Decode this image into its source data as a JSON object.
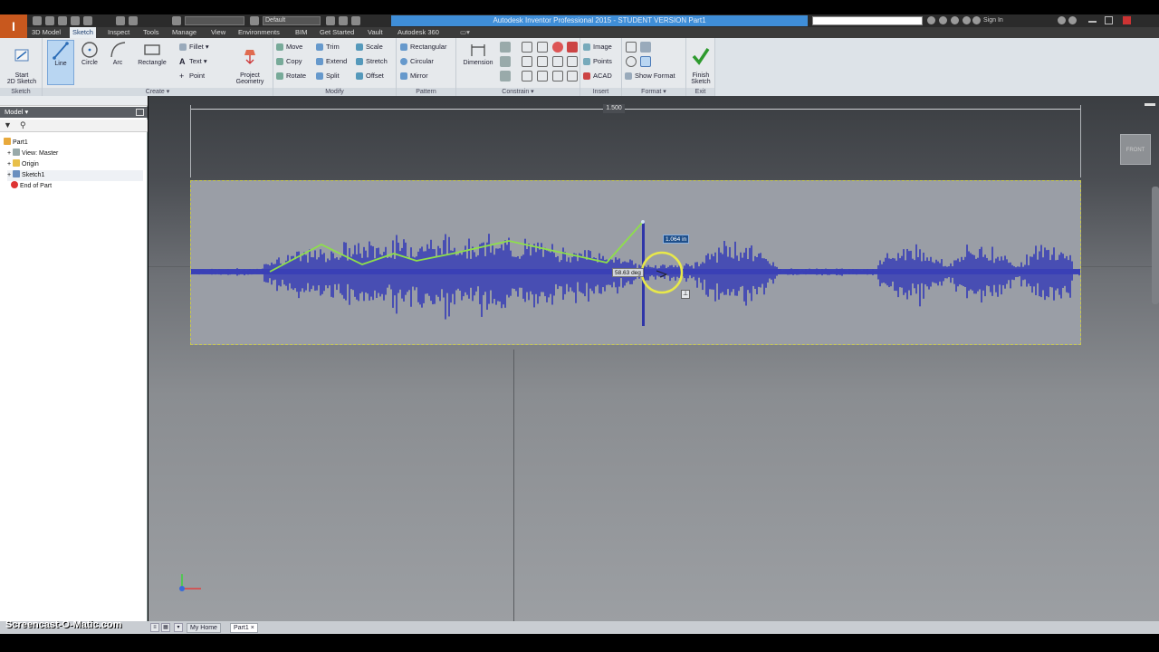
{
  "app": {
    "title": "Autodesk Inventor Professional 2015 - STUDENT VERSION   Part1",
    "logo_letter": "I",
    "appearance_value": "Default",
    "signin_label": "Sign In",
    "colors": {
      "accent": "#3f8ed8",
      "ribbon": "#e6e9ec",
      "brand": "#c8581e"
    }
  },
  "tabs": [
    {
      "label": "3D Model"
    },
    {
      "label": "Sketch",
      "active": true
    },
    {
      "label": "Inspect"
    },
    {
      "label": "Tools"
    },
    {
      "label": "Manage"
    },
    {
      "label": "View"
    },
    {
      "label": "Environments"
    },
    {
      "label": "BIM"
    },
    {
      "label": "Get Started"
    },
    {
      "label": "Vault"
    },
    {
      "label": "Autodesk 360"
    }
  ],
  "ribbon": {
    "sketch": {
      "panel": "Sketch",
      "start": "Start\n2D Sketch"
    },
    "create": {
      "panel": "Create ▾",
      "line": "Line",
      "circle": "Circle",
      "arc": "Arc",
      "rectangle": "Rectangle",
      "fillet": "Fillet",
      "text": "Text",
      "point": "Point",
      "project": "Project\nGeometry"
    },
    "modify": {
      "panel": "Modify",
      "move": "Move",
      "trim": "Trim",
      "scale": "Scale",
      "copy": "Copy",
      "extend": "Extend",
      "stretch": "Stretch",
      "rotate": "Rotate",
      "split": "Split",
      "offset": "Offset"
    },
    "pattern": {
      "panel": "Pattern",
      "rectangular": "Rectangular",
      "circular": "Circular",
      "mirror": "Mirror"
    },
    "constrain": {
      "panel": "Constrain ▾",
      "dimension": "Dimension"
    },
    "insert": {
      "panel": "Insert",
      "image": "Image",
      "points": "Points",
      "acad": "ACAD"
    },
    "format": {
      "panel": "Format ▾",
      "show_format": "Show Format"
    },
    "exit": {
      "panel": "Exit",
      "finish": "Finish\nSketch"
    }
  },
  "browser": {
    "header": "Model ▾",
    "items": [
      {
        "label": "Part1"
      },
      {
        "label": "View: Master"
      },
      {
        "label": "Origin"
      },
      {
        "label": "Sketch1"
      },
      {
        "label": "End of Part"
      }
    ]
  },
  "viewport": {
    "dimension_value": "1.500",
    "length_input": "1.064 in",
    "angle_input": "58.63 deg",
    "viewcube_label": "FRONT"
  },
  "doc_tabs": [
    {
      "label": "My Home"
    },
    {
      "label": "Part1",
      "active": true
    }
  ],
  "watermark": "Screencast-O-Matic.com"
}
